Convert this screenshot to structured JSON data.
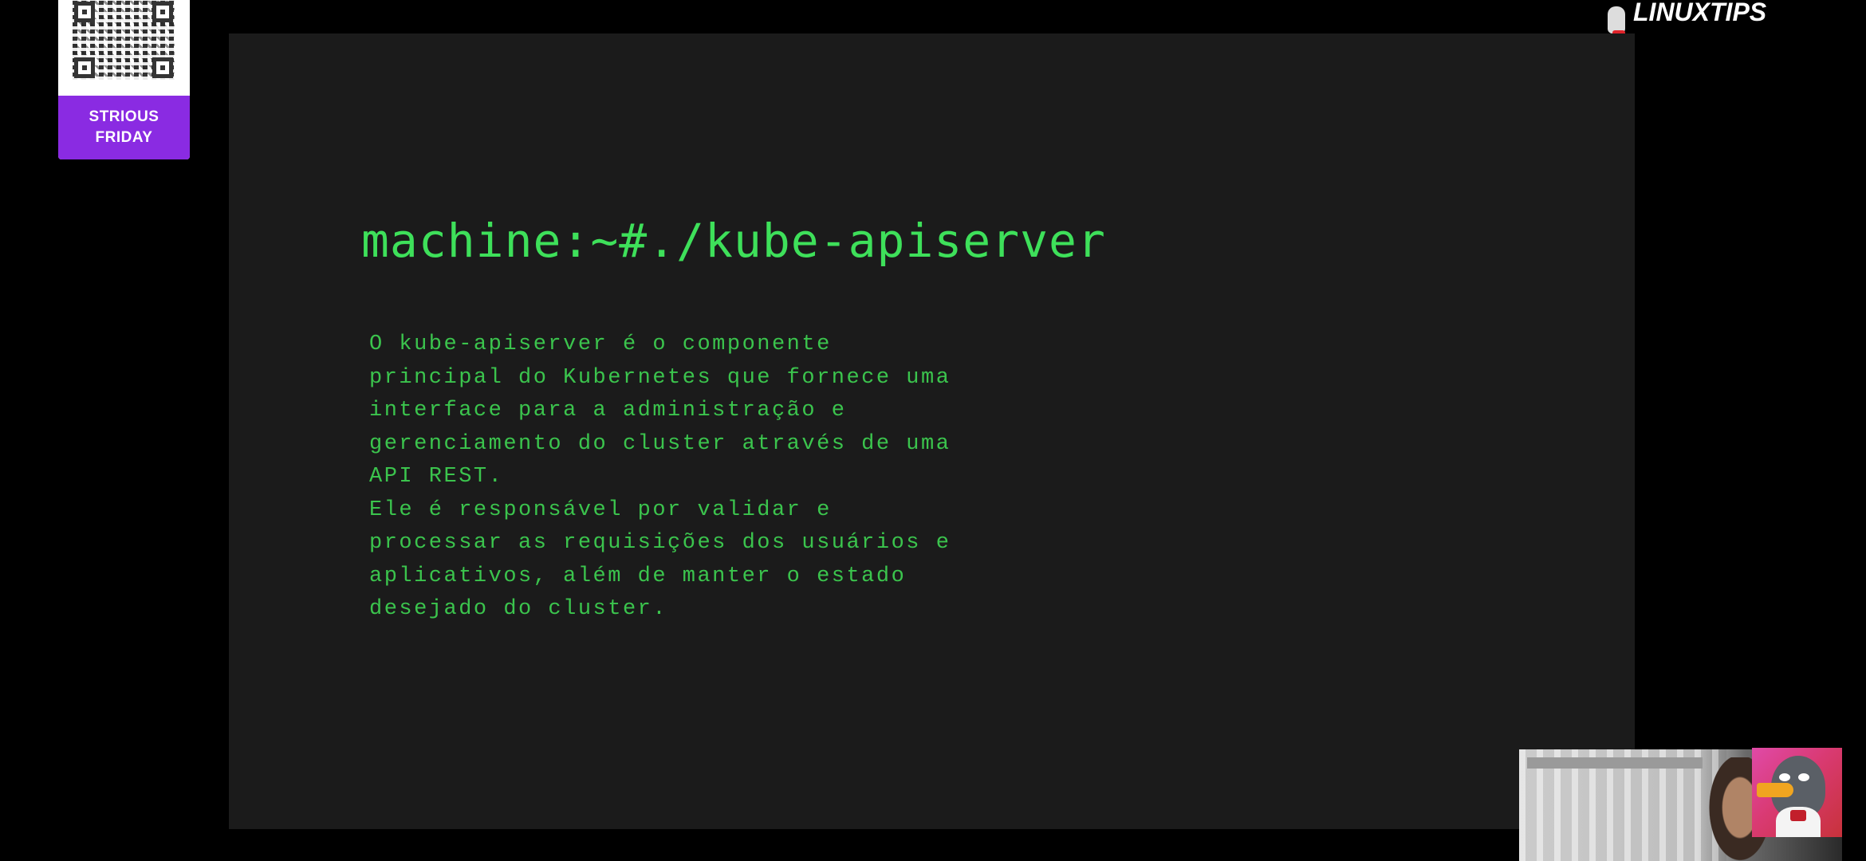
{
  "overlay": {
    "qr_label_line1": "STRIOUS",
    "qr_label_line2": "FRIDAY",
    "qr_color": "#8a2be2",
    "brand_name": "LINUXTIPS"
  },
  "slide": {
    "title": "machine:~#./kube-apiserver",
    "body_lines": [
      "O kube-apiserver é o componente",
      "principal do Kubernetes que fornece uma",
      "interface para a administração e",
      "gerenciamento do cluster através de uma",
      "API REST.",
      "Ele é responsável por validar e",
      "processar as requisições dos usuários e",
      "aplicativos, além de manter o estado",
      "desejado do cluster."
    ],
    "text_color": "#3ee05a",
    "background_color": "#1b1b1b"
  },
  "icons": {
    "qr": "qr-code-icon",
    "brand": "penguin-logo-icon",
    "mascot": "penguin-mascot-icon"
  }
}
